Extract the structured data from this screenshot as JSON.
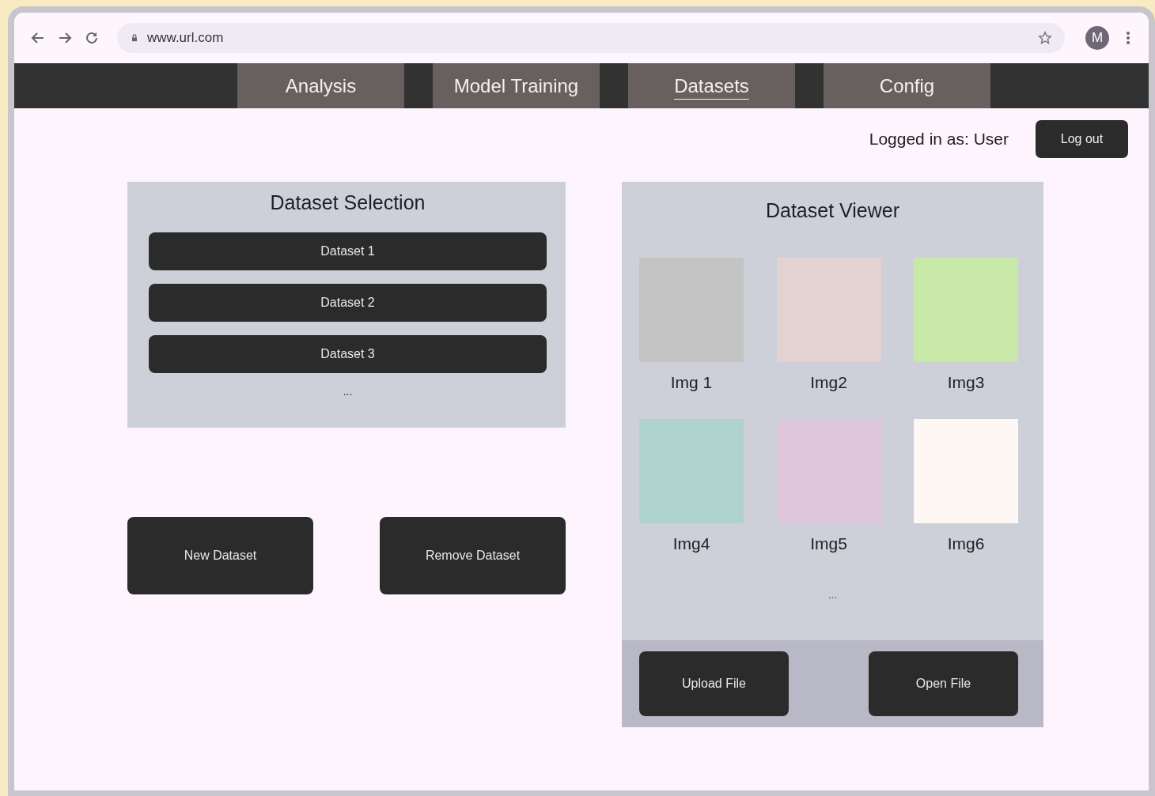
{
  "browser": {
    "url": "www.url.com",
    "profile_initial": "M"
  },
  "tabs": [
    {
      "label": "Analysis",
      "selected": false
    },
    {
      "label": "Model Training",
      "selected": false
    },
    {
      "label": "Datasets",
      "selected": true
    },
    {
      "label": "Config",
      "selected": false
    }
  ],
  "user": {
    "status": "Logged in as: User",
    "logout": "Log out"
  },
  "dataset_selection": {
    "title": "Dataset Selection",
    "datasets": [
      "Dataset 1",
      "Dataset 2",
      "Dataset 3"
    ],
    "more": "...",
    "actions": [
      "New Dataset",
      "Remove Dataset"
    ]
  },
  "dataset_viewer": {
    "title": "Dataset Viewer",
    "images": [
      {
        "label": "Img 1",
        "color": "#c4c4c4"
      },
      {
        "label": "Img2",
        "color": "#e4d2d2"
      },
      {
        "label": "Img3",
        "color": "#c8e8a8"
      },
      {
        "label": "Img4",
        "color": "#b0d2cc"
      },
      {
        "label": "Img5",
        "color": "#e0c6dc"
      },
      {
        "label": "Img6",
        "color": "#fff7f4"
      }
    ],
    "more": "...",
    "actions": [
      "Upload File",
      "Open File"
    ]
  }
}
